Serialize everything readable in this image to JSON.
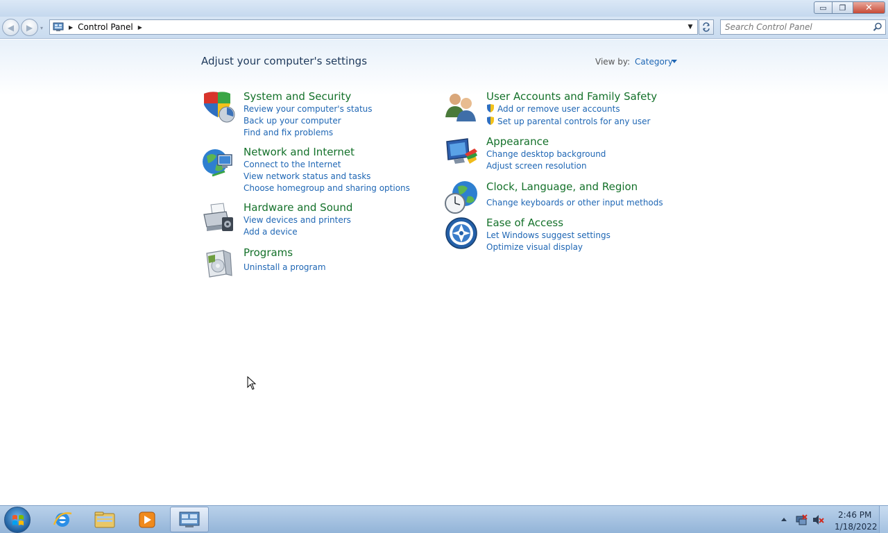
{
  "window": {
    "caption": {
      "minimize": "▭",
      "maximize": "❐",
      "close": "✕"
    }
  },
  "nav": {
    "back": "◀",
    "forward": "▶",
    "recent": "▾",
    "breadcrumb": {
      "sep1": "▶",
      "location": "Control Panel",
      "sep2": "▶"
    },
    "dropdown": "▼",
    "search_placeholder": "Search Control Panel"
  },
  "content": {
    "title": "Adjust your computer's settings",
    "view_by_label": "View by:",
    "view_by_value": "Category",
    "left_categories": [
      {
        "title": "System and Security",
        "links": [
          "Review your computer's status",
          "Back up your computer",
          "Find and fix problems"
        ]
      },
      {
        "title": "Network and Internet",
        "links": [
          "Connect to the Internet",
          "View network status and tasks",
          "Choose homegroup and sharing options"
        ]
      },
      {
        "title": "Hardware and Sound",
        "links": [
          "View devices and printers",
          "Add a device"
        ]
      },
      {
        "title": "Programs",
        "links": [
          "Uninstall a program"
        ]
      }
    ],
    "right_categories": [
      {
        "title": "User Accounts and Family Safety",
        "links": [
          "Add or remove user accounts",
          "Set up parental controls for any user"
        ]
      },
      {
        "title": "Appearance",
        "links": [
          "Change desktop background",
          "Adjust screen resolution"
        ]
      },
      {
        "title": "Clock, Language, and Region",
        "links": [
          "Change keyboards or other input methods"
        ]
      },
      {
        "title": "Ease of Access",
        "links": [
          "Let Windows suggest settings",
          "Optimize visual display"
        ]
      }
    ]
  },
  "taskbar": {
    "clock_time": "2:46 PM",
    "clock_date": "1/18/2022"
  },
  "icons": {
    "system_security": "shield-icon",
    "network": "globe-network-icon",
    "hardware": "printer-icon",
    "programs": "programs-box-icon",
    "users": "users-icon",
    "appearance": "monitor-palette-icon",
    "clock": "clock-globe-icon",
    "ease": "ease-of-access-icon"
  },
  "colors": {
    "category_title": "#14712a",
    "link": "#1e66b4",
    "page_title": "#1e395b"
  }
}
